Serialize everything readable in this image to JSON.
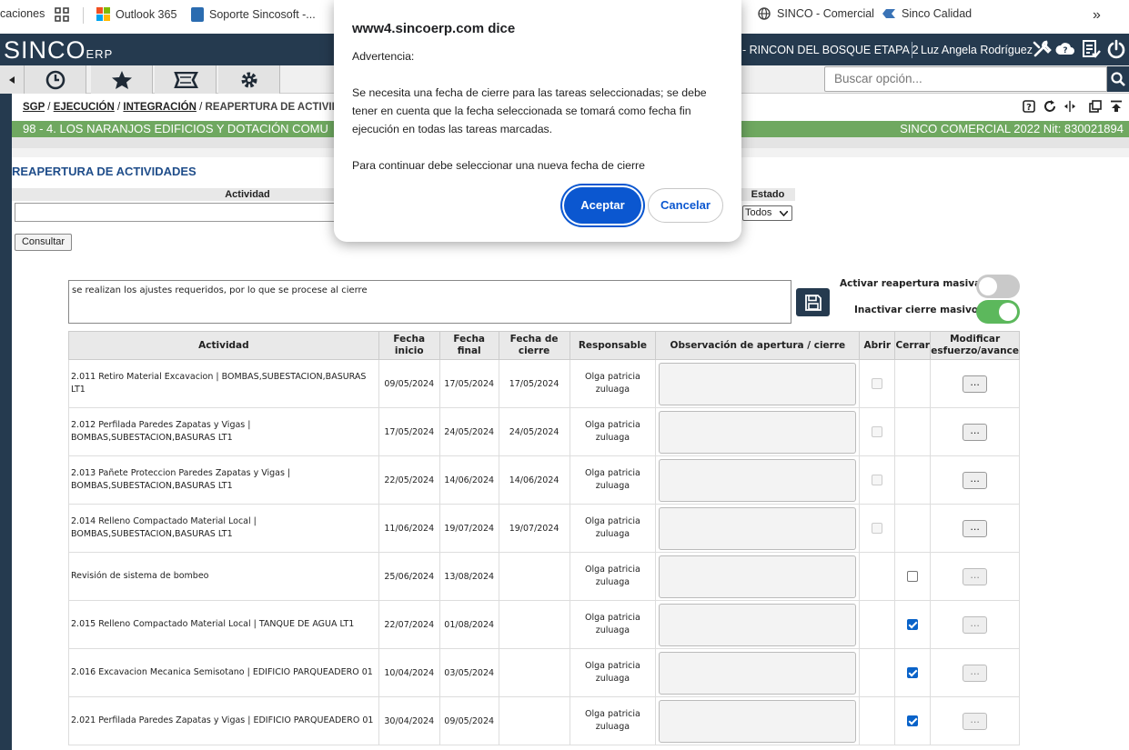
{
  "bookmarks": {
    "apps_label": "caciones",
    "items": [
      {
        "label": "Outlook 365",
        "icon": "microsoft-icon"
      },
      {
        "label": "Soporte Sincosoft -...",
        "icon": "sincosoft-icon"
      },
      {
        "label": "SINCO - Comercial",
        "icon": "globe-icon"
      },
      {
        "label": "Sinco Calidad",
        "icon": "sinco-icon"
      }
    ],
    "more": "»"
  },
  "header": {
    "logo_main": "SINCO",
    "logo_sub": "ERP",
    "project": "- RINCON DEL BOSQUE ETAPA 2",
    "user": "Luz Angela Rodríguez"
  },
  "toolbar": {
    "buttons": [
      "history-icon",
      "star-icon",
      "ticket-icon",
      "gear-icon"
    ]
  },
  "search": {
    "placeholder": "Buscar opción..."
  },
  "breadcrumb": {
    "root": "SGP",
    "level1": "EJECUCIÓN",
    "level2": "INTEGRACIÓN",
    "current": "REAPERTURA DE ACTIVIDAD",
    "sep": "/"
  },
  "banner": {
    "left": "98 - 4. LOS NARANJOS EDIFICIOS Y DOTACIÓN COMU",
    "right": "SINCO COMERCIAL 2022 Nit: 830021894"
  },
  "page_title": "REAPERTURA DE ACTIVIDADES",
  "filters": {
    "activity_label": "Actividad",
    "status_label": "Estado",
    "status_value": "Todos",
    "consult_button": "Consultar"
  },
  "observation": {
    "value": "se realizan los ajustes requeridos, por lo que se procese al cierre"
  },
  "toggles": {
    "reopen_label": "Activar reapertura masiva",
    "reopen_on": false,
    "close_label": "Inactivar cierre masivo",
    "close_on": true
  },
  "colors": {
    "header": "#253a4f",
    "banner": "#6fa860",
    "toggle_on": "#5cb85c",
    "primary": "#0b57d0"
  },
  "table": {
    "headers": {
      "activity": "Actividad",
      "start": "Fecha inicio",
      "end": "Fecha final",
      "close": "Fecha de cierre",
      "resp": "Responsable",
      "obs": "Observación de apertura / cierre",
      "open": "Abrir",
      "shut": "Cerrar",
      "modify": "Modificar esfuerzo/avance"
    },
    "rows": [
      {
        "activity": "2.011 Retiro Material Excavacion | BOMBAS,SUBESTACION,BASURAS LT1",
        "start": "09/05/2024",
        "end": "17/05/2024",
        "close": "17/05/2024",
        "resp": "Olga patricia zuluaga",
        "open": "disabled",
        "shut": "none",
        "btn": "..."
      },
      {
        "activity": "2.012 Perfilada Paredes Zapatas y Vigas | BOMBAS,SUBESTACION,BASURAS LT1",
        "start": "17/05/2024",
        "end": "24/05/2024",
        "close": "24/05/2024",
        "resp": "Olga patricia zuluaga",
        "open": "disabled",
        "shut": "none",
        "btn": "..."
      },
      {
        "activity": "2.013 Pañete Proteccion Paredes Zapatas y Vigas | BOMBAS,SUBESTACION,BASURAS LT1",
        "start": "22/05/2024",
        "end": "14/06/2024",
        "close": "14/06/2024",
        "resp": "Olga patricia zuluaga",
        "open": "disabled",
        "shut": "none",
        "btn": "..."
      },
      {
        "activity": "2.014 Relleno Compactado Material Local | BOMBAS,SUBESTACION,BASURAS LT1",
        "start": "11/06/2024",
        "end": "19/07/2024",
        "close": "19/07/2024",
        "resp": "Olga patricia zuluaga",
        "open": "disabled",
        "shut": "none",
        "btn": "..."
      },
      {
        "activity": "Revisión de sistema de bombeo",
        "start": "25/06/2024",
        "end": "13/08/2024",
        "close": "",
        "resp": "Olga patricia zuluaga",
        "open": "none",
        "shut": "unchecked",
        "btn": "..."
      },
      {
        "activity": "2.015 Relleno Compactado Material Local | TANQUE DE AGUA LT1",
        "start": "22/07/2024",
        "end": "01/08/2024",
        "close": "",
        "resp": "Olga patricia zuluaga",
        "open": "none",
        "shut": "checked",
        "btn": "..."
      },
      {
        "activity": "2.016 Excavacion Mecanica Semisotano | EDIFICIO PARQUEADERO 01",
        "start": "10/04/2024",
        "end": "03/05/2024",
        "close": "",
        "resp": "Olga patricia zuluaga",
        "open": "none",
        "shut": "checked",
        "btn": "..."
      },
      {
        "activity": "2.021 Perfilada Paredes Zapatas y Vigas | EDIFICIO PARQUEADERO 01",
        "start": "30/04/2024",
        "end": "09/05/2024",
        "close": "",
        "resp": "Olga patricia zuluaga",
        "open": "none",
        "shut": "checked",
        "btn": "..."
      }
    ]
  },
  "dialog": {
    "title": "www4.sincoerp.com dice",
    "heading": "Advertencia:",
    "message": "Se necesita una fecha de cierre para las tareas seleccionadas; se debe tener en cuenta que la fecha seleccionada se tomará como fecha fin ejecución en todas las tareas marcadas.",
    "instruction": "Para continuar debe seleccionar una nueva fecha de cierre",
    "ok": "Aceptar",
    "cancel": "Cancelar"
  }
}
